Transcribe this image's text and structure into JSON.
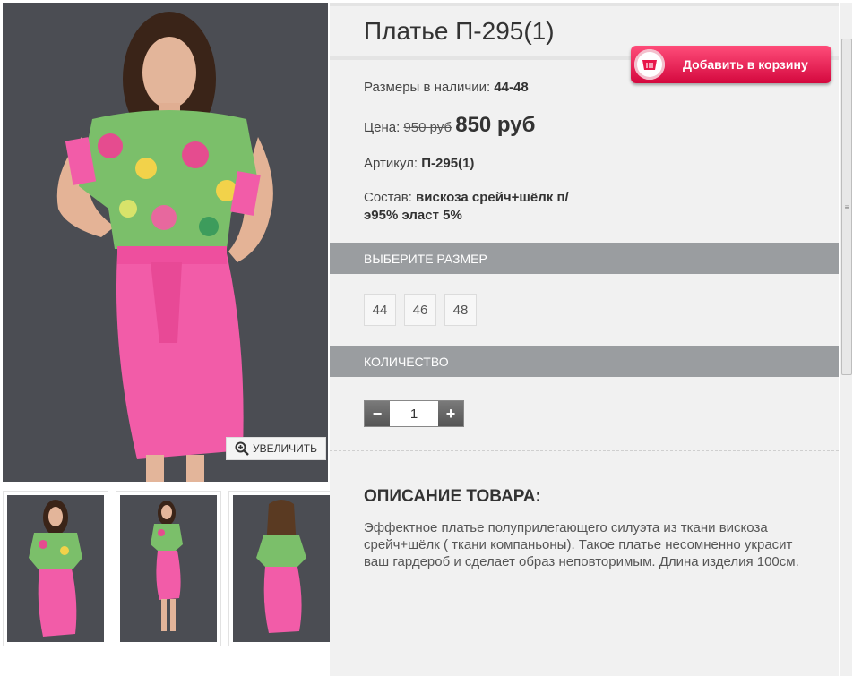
{
  "product": {
    "title": "Платье П-295(1)",
    "sizes_label": "Размеры в наличии:",
    "sizes_value": "44-48",
    "price_label": "Цена:",
    "price_old": "950 руб",
    "price_new": "850 руб",
    "sku_label": "Артикул:",
    "sku_value": "П-295(1)",
    "composition_label": "Состав:",
    "composition_value": "вискоза срейч+шёлк п/э95% эласт 5%"
  },
  "cart": {
    "label": "Добавить в корзину"
  },
  "size_section": {
    "title": "ВЫБЕРИТЕ РАЗМЕР",
    "options": [
      "44",
      "46",
      "48"
    ]
  },
  "quantity_section": {
    "title": "КОЛИЧЕСТВО",
    "minus": "−",
    "plus": "+",
    "value": "1"
  },
  "description": {
    "title": "ОПИСАНИЕ ТОВАРА:",
    "text": "Эффектное платье полуприлегающего силуэта из ткани вискоза срейч+шёлк ( ткани компаньоны). Такое платье несомненно украсит ваш гардероб и сделает образ неповторимым. Длина изделия 100см."
  },
  "gallery": {
    "zoom_label": "УВЕЛИЧИТЬ",
    "thumbnails": 3
  },
  "colors": {
    "accent": "#e8164a",
    "section_bar": "#9a9da0",
    "dress_pink": "#f25ca8"
  }
}
